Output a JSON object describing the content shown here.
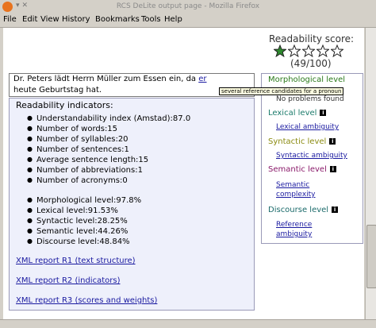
{
  "window": {
    "title": "RCS DeLite output page - Mozilla Firefox"
  },
  "menu": [
    "File",
    "Edit",
    "View",
    "History",
    "Bookmarks",
    "Tools",
    "Help"
  ],
  "score": {
    "label": "Readability score:",
    "value": "(49/100)",
    "stars_filled": 1,
    "stars_total": 5
  },
  "text": {
    "line1": "Dr. Peters lädt Herrn Müller zum Essen ein, da",
    "link": "er",
    "line2": "heute Geburtstag hat."
  },
  "indicators": {
    "title": "Readability indicators:",
    "list1": [
      "Understandability index (Amstad):87.0",
      "Number of words:15",
      "Number of syllables:20",
      "Number of sentences:1",
      "Average sentence length:15",
      "Number of abbreviations:1",
      "Number of acronyms:0"
    ],
    "list2": [
      "Morphological level:97.8%",
      "Lexical level:91.53%",
      "Syntactic level:28.25%",
      "Semantic level:44.26%",
      "Discourse level:48.84%"
    ],
    "links": [
      "XML report R1 (text structure)",
      "XML report R2 (indicators)",
      "XML report R3 (scores and weights)"
    ]
  },
  "levels": {
    "morphological": {
      "label": "Morphological level",
      "item": "No problems found",
      "color": "#2a7a1a"
    },
    "lexical": {
      "label": "Lexical level",
      "item": "Lexical ambiguity",
      "color": "#1a7a6a"
    },
    "syntactic": {
      "label": "Syntactic level",
      "item": "Syntactic ambiguity",
      "color": "#8a8a10"
    },
    "semantic": {
      "label": "Semantic level",
      "item1": "Semantic",
      "item2": "complexity",
      "color": "#8a1a6a"
    },
    "discourse": {
      "label": "Discourse level",
      "item1": "Reference",
      "item2": "ambiguity",
      "color": "#1a6a6a"
    }
  },
  "tooltip": "several reference candidates for a pronoun"
}
